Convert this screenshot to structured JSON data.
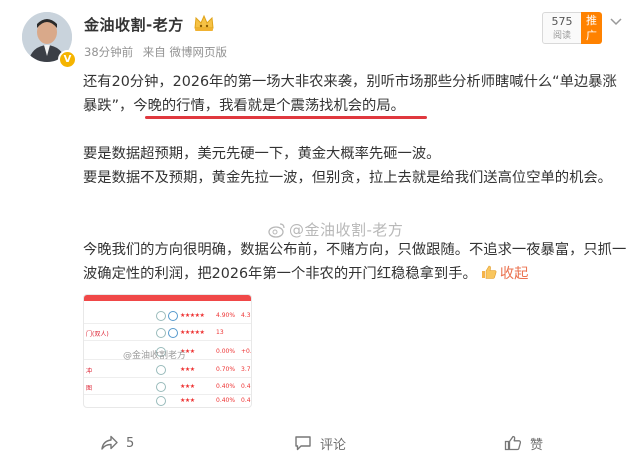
{
  "post": {
    "author": "金油收割-老方",
    "time": "38分钟前",
    "source": "来自 微博网页版",
    "read_count": "575",
    "read_label": "阅读",
    "promote_label": "推广",
    "paragraphs": {
      "p1": "还有20分钟，2026年的第一场大非农来袭，别听市场那些分析师瞎喊什么“单边暴涨暴跌”，今晚的行情，我看就是个震荡找机会的局。",
      "p2": "要是数据超预期，美元先硬一下，黄金大概率先砸一波。",
      "p3": "要是数据不及预期，黄金先拉一波，但别贪，拉上去就是给我们送高位空单的机会。",
      "p4": "今晚我们的方向很明确，数据公布前，不赌方向，只做跟随。不追求一夜暴富，只抓一波确定性的利润，把2026年第一个非农的开门红稳稳拿到手。"
    },
    "collapse_label": "收起",
    "watermark": "@金油收割-老方",
    "image_watermark": "@金油收割老方",
    "image_rows": [
      {
        "name": "",
        "stars": "★★★★★",
        "pct": "4.90%",
        "x": "4.3"
      },
      {
        "name": "门(双人)",
        "stars": "★★★★★",
        "pct": "13",
        "x": ""
      },
      {
        "name": "",
        "stars": "★★★",
        "pct": "0.00%",
        "x": "+0."
      },
      {
        "name": "冲",
        "stars": "★★★",
        "pct": "0.70%",
        "x": "3.7"
      },
      {
        "name": "图",
        "stars": "★★★",
        "pct": "0.40%",
        "x": "0.4"
      },
      {
        "name": "",
        "stars": "★★★",
        "pct": "0.40%",
        "x": "0.4"
      }
    ]
  },
  "actions": {
    "share_count": "5",
    "comment_label": "评论",
    "like_label": "赞"
  },
  "colors": {
    "highlight_underline": "#e0383e",
    "promote": "#ff8200",
    "collapse_link": "#eb7350",
    "badge": "#f5b400"
  }
}
